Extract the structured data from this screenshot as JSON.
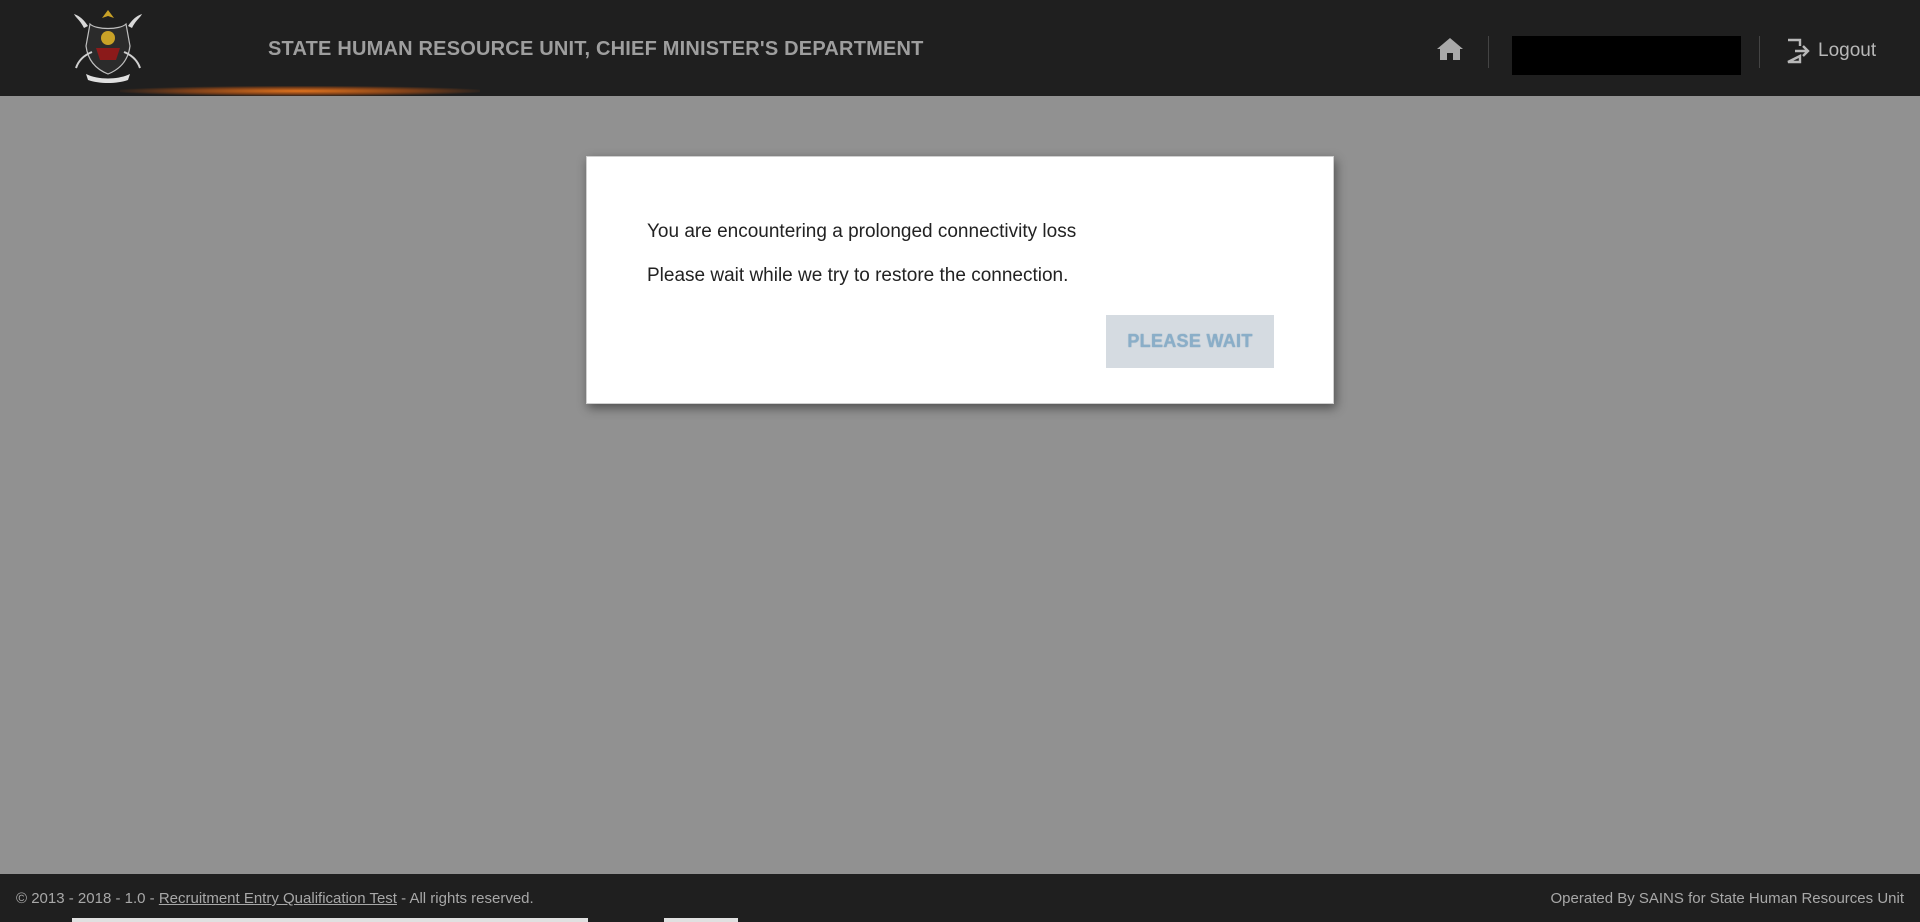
{
  "header": {
    "title": "STATE HUMAN RESOURCE UNIT, CHIEF MINISTER'S DEPARTMENT",
    "home_icon": "home-icon",
    "logout_icon": "logout-icon",
    "logout_label": "Logout"
  },
  "dialog": {
    "line1": "You are encountering a prolonged connectivity loss",
    "line2": "Please wait while we try to restore the connection.",
    "button_label": "PLEASE WAIT"
  },
  "footer": {
    "copyright": "© 2013 - 2018 - 1.0 - ",
    "link_label": "Recruitment Entry Qualification Test",
    "rights": " - All rights reserved.",
    "operated_by": "Operated By SAINS for State Human Resources Unit"
  },
  "colors": {
    "header_bg": "#1f1f1f",
    "overlay": "#919191",
    "accent_glow": "#eb781e",
    "button_bg": "#d5dbe1",
    "button_text": "#8aaec8"
  }
}
